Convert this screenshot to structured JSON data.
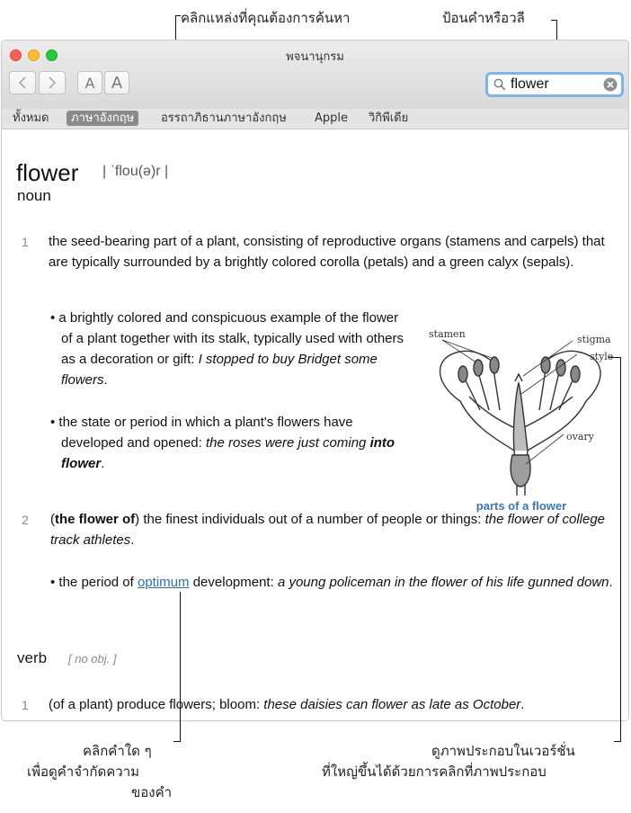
{
  "callouts": {
    "click_source": "คลิกแหล่งที่คุณต้องการค้นหา",
    "type_word": "ป้อนคำหรือวลี",
    "click_word_line1": "คลิกคำใด ๆ",
    "click_word_line2": "เพื่อดูคำจำกัดความ",
    "click_word_line3": "ของคำ",
    "view_image_line1": "ดูภาพประกอบในเวอร์ชั่น",
    "view_image_line2": "ที่ใหญ่ขึ้นได้ด้วยการคลิกที่ภาพประกอบ"
  },
  "window": {
    "title": "พจนานุกรม",
    "font_smaller": "A",
    "font_larger": "A",
    "search": {
      "value": "flower",
      "placeholder": ""
    }
  },
  "tabs": [
    {
      "label": "ทั้งหมด",
      "active": false
    },
    {
      "label": "ภาษาอังกฤษ",
      "active": true
    },
    {
      "label": "อรรถาภิธานภาษาอังกฤษ",
      "active": false
    },
    {
      "label": "Apple",
      "active": false
    },
    {
      "label": "วิกิพีเดีย",
      "active": false
    }
  ],
  "entry": {
    "headword": "flower",
    "pronunciation": "| ˈflou(ə)r |",
    "pos_noun": "noun",
    "sense1_num": "1",
    "sense1_text": "the seed-bearing part of a plant, consisting of reproductive organs (stamens and carpels) that are typically surrounded by a brightly colored corolla (petals) and a green calyx (sepals).",
    "sub1_text": "a brightly colored and conspicuous example of the flower of a plant together with its stalk, typically used with others as a decoration or gift:",
    "sub1_example": "I stopped to buy Bridget some flowers",
    "sub2_text": "the state or period in which a plant's flowers have developed and opened:",
    "sub2_example": "the roses were just coming",
    "sub2_example_bold": "into flower",
    "sense2_num": "2",
    "sense2_bold": "the flower of",
    "sense2_text": "the finest individuals out of a number of people or things:",
    "sense2_example": "the flower of college track athletes",
    "sub3_pre": "the period of",
    "sub3_link": "optimum",
    "sub3_post": "development:",
    "sub3_example": "a young policeman in the flower of his life gunned down",
    "pos_verb": "verb",
    "verb_note": "[ no obj. ]",
    "verb1_num": "1",
    "verb1_text": "(of a plant) produce flowers; bloom:",
    "verb1_example": "these daisies can flower as late as October"
  },
  "figure": {
    "caption": "parts of a flower",
    "labels": {
      "stamen": "stamen",
      "stigma": "stigma",
      "style": "style",
      "ovary": "ovary"
    }
  }
}
